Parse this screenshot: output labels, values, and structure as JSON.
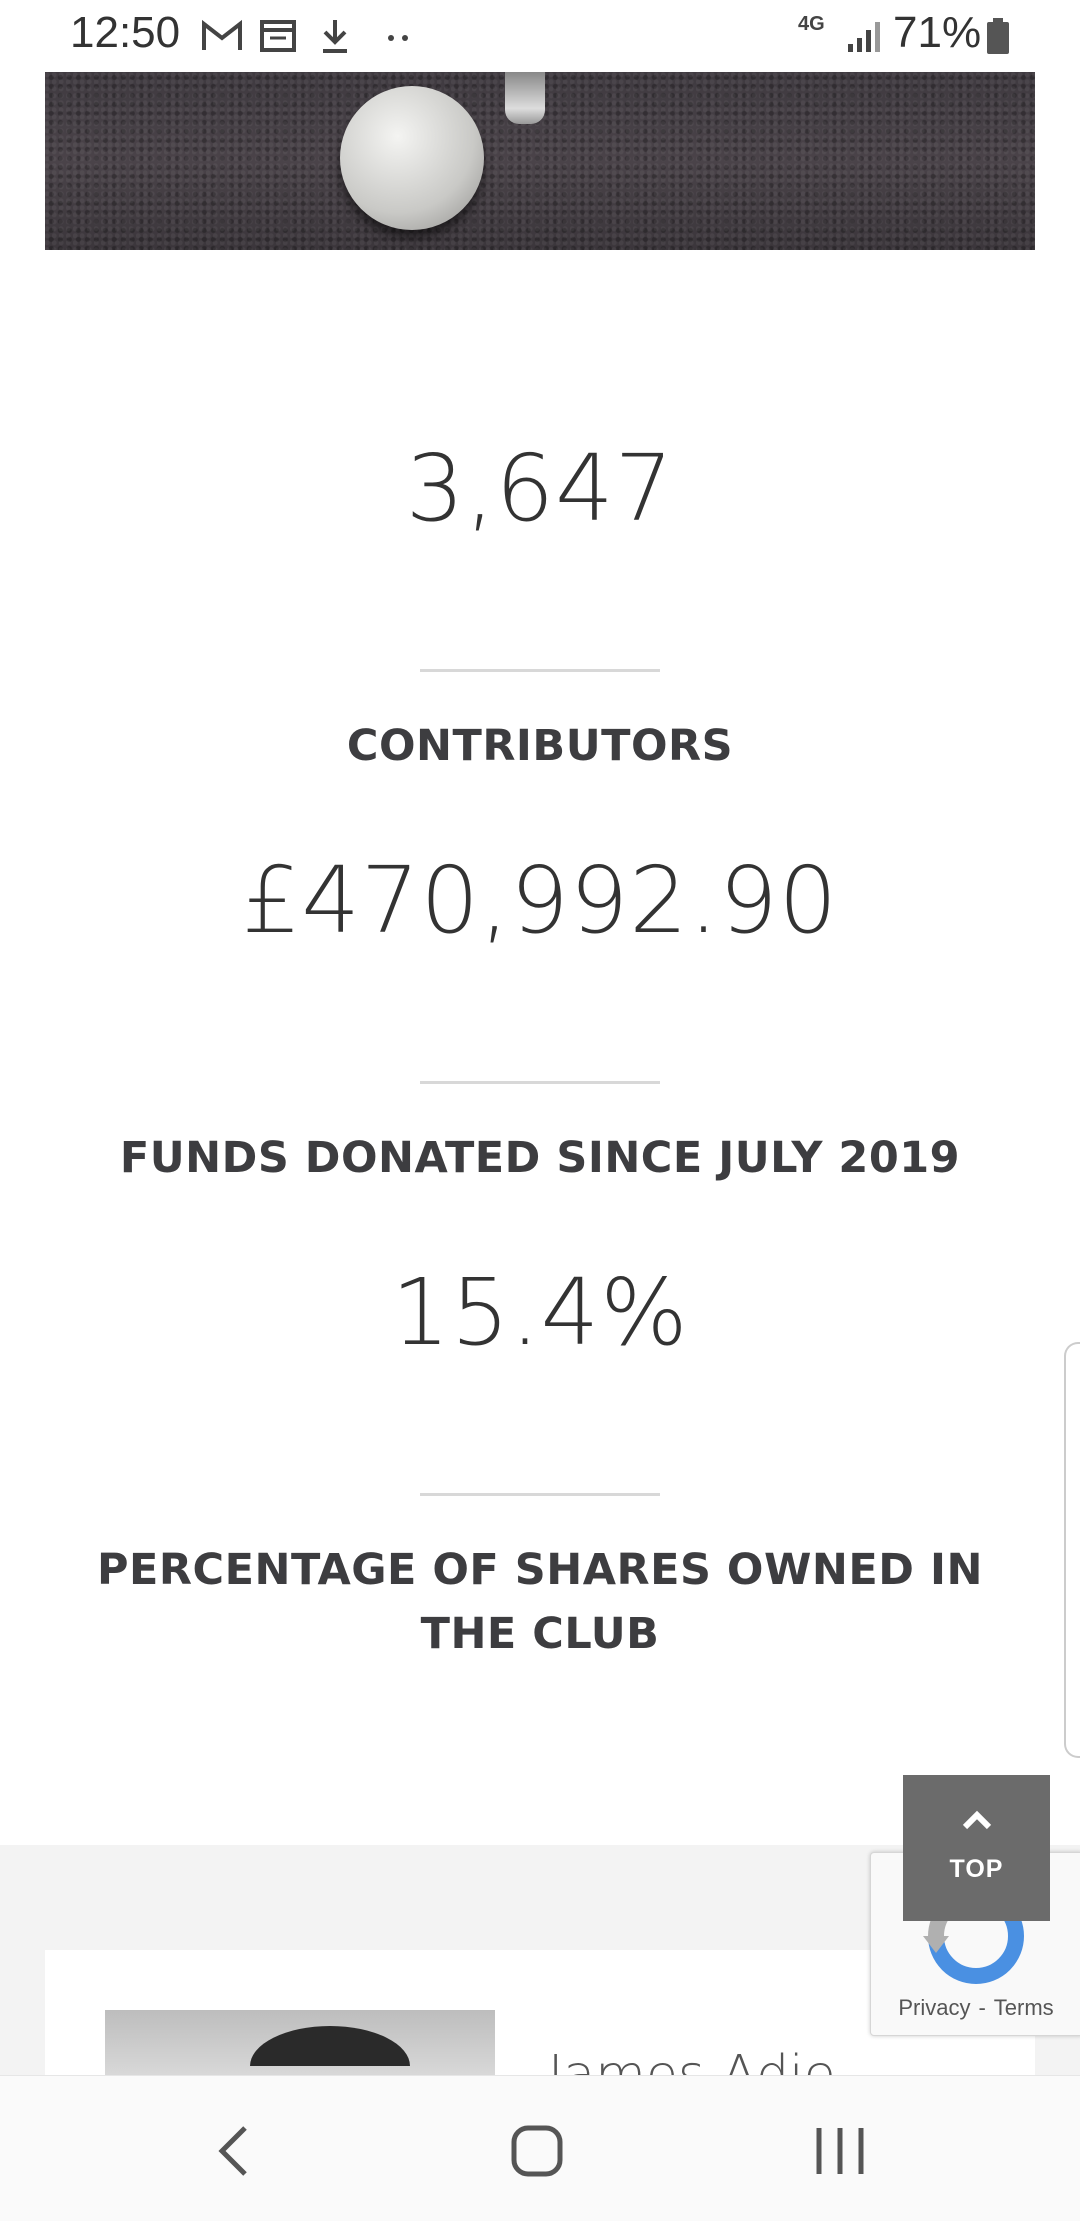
{
  "status_bar": {
    "time": "12:50",
    "icons": [
      "gmail-icon",
      "calendar-icon",
      "download-icon",
      "more-dots-icon"
    ],
    "network": "4G",
    "battery": "71%"
  },
  "stats": [
    {
      "value": "3,647",
      "label": "CONTRIBUTORS"
    },
    {
      "value": "£470,992.90",
      "label": "FUNDS DONATED SINCE JULY 2019"
    },
    {
      "value": "15.4%",
      "label": "PERCENTAGE OF SHARES OWNED IN THE CLUB"
    }
  ],
  "person": {
    "name": "James Adie"
  },
  "top_button": {
    "label": "TOP"
  },
  "recaptcha": {
    "privacy": "Privacy",
    "separator": "-",
    "terms": "Terms"
  },
  "navbar": {
    "back": "back-icon",
    "home": "home-icon",
    "recents": "recents-icon"
  }
}
